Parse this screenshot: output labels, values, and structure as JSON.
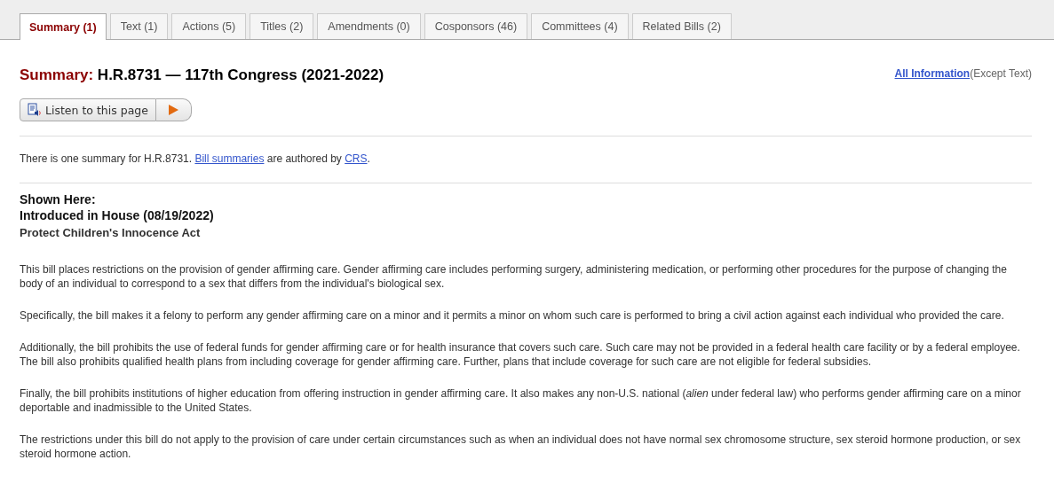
{
  "tabs": [
    {
      "label": "Summary (1)",
      "selected": true
    },
    {
      "label": "Text (1)",
      "selected": false
    },
    {
      "label": "Actions (5)",
      "selected": false
    },
    {
      "label": "Titles (2)",
      "selected": false
    },
    {
      "label": "Amendments (0)",
      "selected": false
    },
    {
      "label": "Cosponsors (46)",
      "selected": false
    },
    {
      "label": "Committees (4)",
      "selected": false
    },
    {
      "label": "Related Bills (2)",
      "selected": false
    }
  ],
  "heading": {
    "prefix": "Summary:",
    "title": "H.R.8731 — 117th Congress (2021-2022)"
  },
  "all_info": {
    "link": "All Information",
    "note": "(Except Text)"
  },
  "listen_button": {
    "label": "Listen to this page"
  },
  "intro": [
    {
      "kind": "text",
      "text": "There is one summary for H.R.8731. "
    },
    {
      "kind": "link",
      "text": "Bill summaries"
    },
    {
      "kind": "text",
      "text": " are authored by "
    },
    {
      "kind": "link",
      "text": "CRS"
    },
    {
      "kind": "text",
      "text": "."
    }
  ],
  "shown_here": {
    "label": "Shown Here:",
    "version": "Introduced in House (08/19/2022)",
    "bill_title": "Protect Children's Innocence Act"
  },
  "paragraphs": [
    "This bill places restrictions on the provision of gender affirming care. Gender affirming care includes performing surgery, administering medication, or performing other procedures for the purpose of changing the body of an individual to correspond to a sex that differs from the individual's biological sex.",
    "Specifically, the bill makes it a felony to perform any gender affirming care on a minor and it permits a minor on whom such care is performed to bring a civil action against each individual who provided the care.",
    "Additionally, the bill prohibits the use of federal funds for gender affirming care or for health insurance that covers such care. Such care may not be provided in a federal health care facility or by a federal employee. The bill also prohibits qualified health plans from including coverage for gender affirming care. Further, plans that include coverage for such care are not eligible for federal subsidies.",
    "Finally, the bill prohibits institutions of higher education from offering instruction in gender affirming care. It also makes any non-U.S. national (*alien* under federal law) who performs gender affirming care on a minor deportable and inadmissible to the United States.",
    "The restrictions under this bill do not apply to the provision of care under certain circumstances such as when an individual does not have normal sex chromosome structure, sex steroid hormone production, or sex steroid hormone action."
  ]
}
